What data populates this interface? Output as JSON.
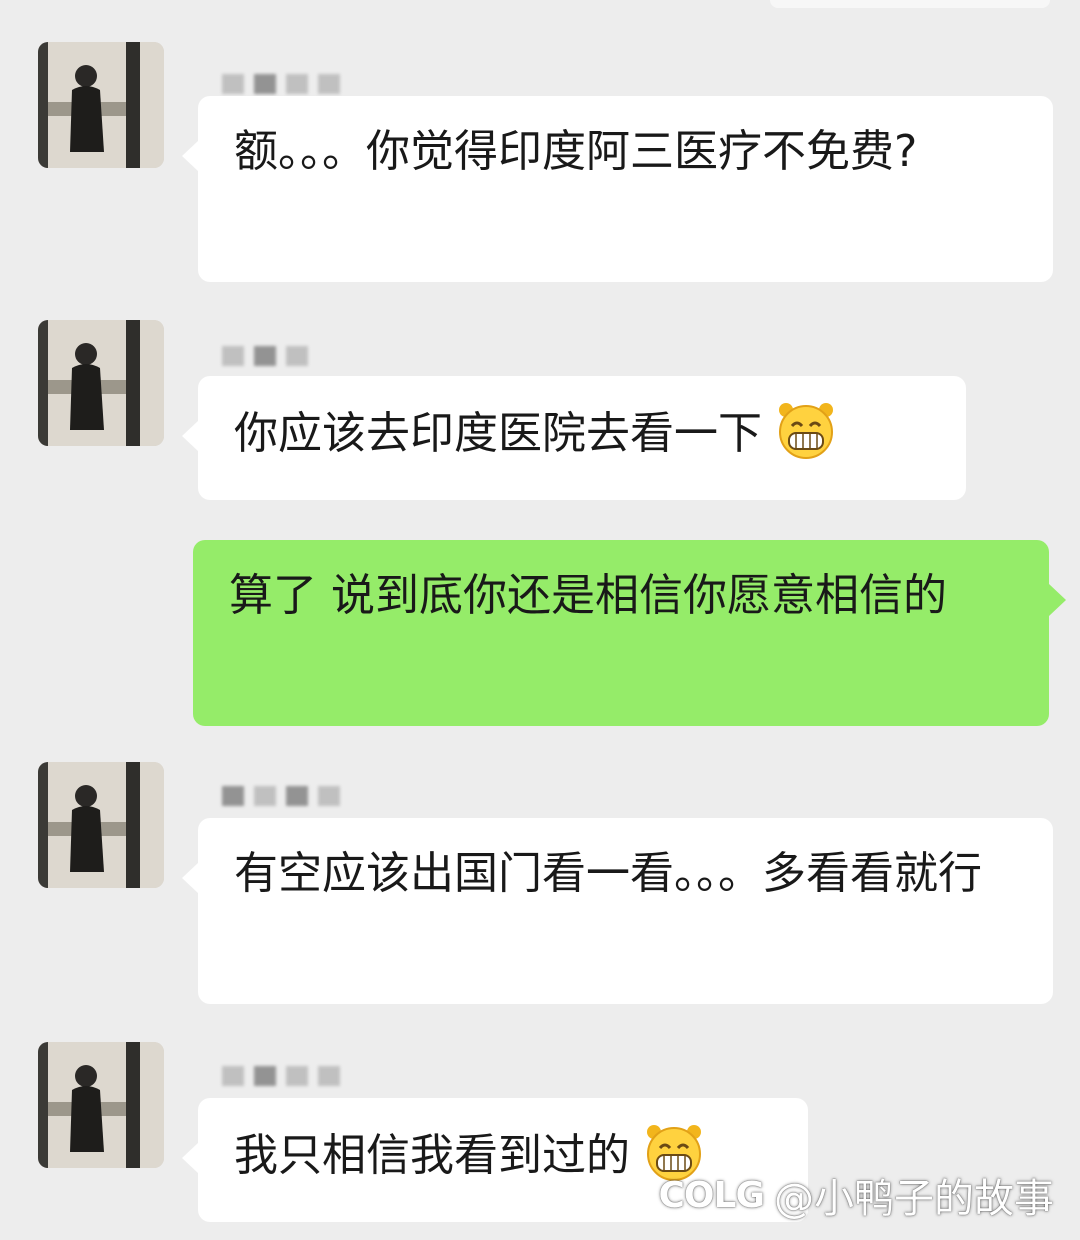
{
  "messages": [
    {
      "side": "in",
      "text": "额。。。你觉得印度阿三医疗不免费?",
      "emoji": ""
    },
    {
      "side": "in",
      "text": "你应该去印度医院去看一下",
      "emoji": "grinning-face-emoji"
    },
    {
      "side": "out",
      "text": "算了  说到底你还是相信你愿意相信的",
      "emoji": ""
    },
    {
      "side": "in",
      "text": "有空应该出国门看一看。。。多看看就行",
      "emoji": ""
    },
    {
      "side": "in",
      "text": "我只相信我看到过的",
      "emoji": "grinning-face-emoji"
    }
  ],
  "watermark": {
    "logo": "COLG",
    "text": "@小鸭子的故事"
  },
  "colors": {
    "background": "#ededed",
    "incoming_bubble": "#ffffff",
    "outgoing_bubble": "#95ec69"
  }
}
